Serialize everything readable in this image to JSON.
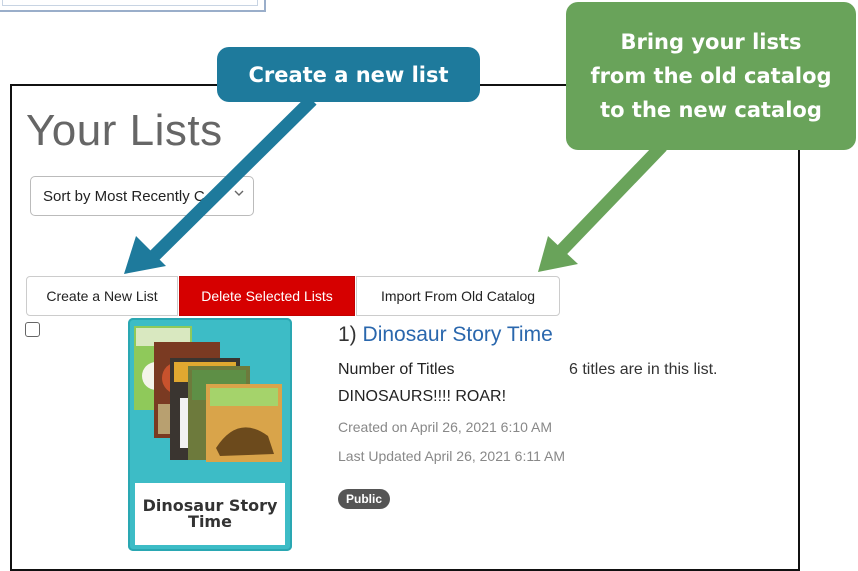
{
  "page": {
    "heading": "Your Lists",
    "sort": {
      "selected": "Sort by Most Recently C"
    },
    "buttons": {
      "create": "Create a New List",
      "delete": "Delete Selected Lists",
      "import": "Import From Old Catalog"
    }
  },
  "list_item": {
    "number": "1)",
    "title": "Dinosaur Story Time",
    "num_titles_label": "Number of Titles",
    "num_titles_value": "6 titles are in this list.",
    "description": "DINOSAURS!!!! ROAR!",
    "created": "Created on April 26, 2021 6:10 AM",
    "updated": "Last Updated April 26, 2021 6:11 AM",
    "badge": "Public",
    "cover_caption": "Dinosaur Story Time"
  },
  "callouts": {
    "create": "Create a new list",
    "import_lines": [
      "Bring your lists",
      "from the old catalog",
      "to the new catalog"
    ]
  },
  "colors": {
    "link": "#2a67ad",
    "delete_button": "#d60000",
    "callout_create": "#1e7a9c",
    "callout_import": "#69a35a",
    "cover_bg": "#3dbcc6"
  },
  "icons": {
    "sort_chevron": "chevron-down-icon",
    "arrow_create": "arrow-down-left-icon",
    "arrow_import": "arrow-down-left-icon"
  }
}
